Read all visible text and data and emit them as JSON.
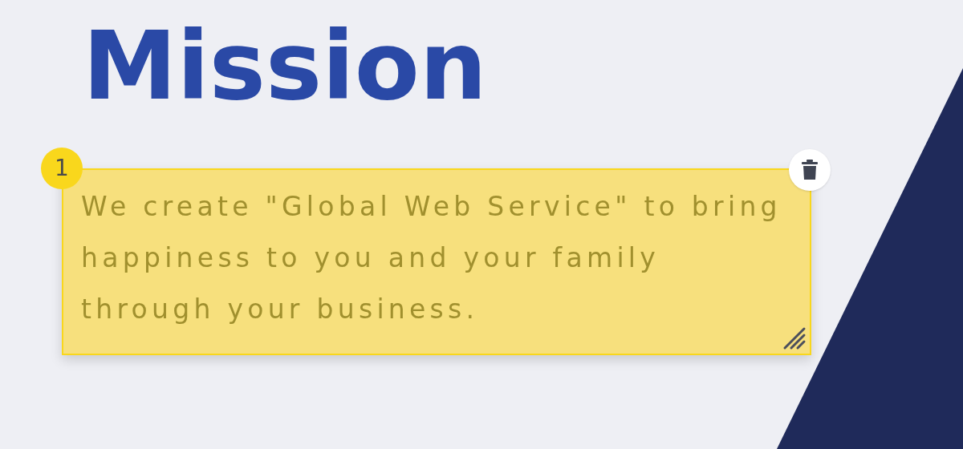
{
  "slide": {
    "title": "Mission",
    "text_box": {
      "text": "We create \"Global Web Service\" to bring happiness to you and your family through your business.",
      "highlighted": true
    }
  },
  "annotation": {
    "number": "1"
  }
}
